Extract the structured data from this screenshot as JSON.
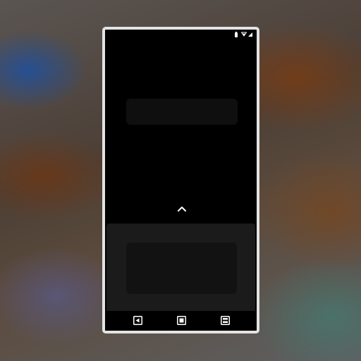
{
  "screen": {
    "status_bar": {
      "icons": [
        "battery-icon",
        "wifi-icon",
        "cellular-signal-icon"
      ]
    },
    "handle_icon": "chevron-up-icon",
    "nav_bar": {
      "buttons": [
        "back-icon",
        "home-icon",
        "recents-icon"
      ]
    }
  },
  "colors": {
    "screen_background": "#000000",
    "sheet_background": "#1b1b1b",
    "card_background": "#121212",
    "frame": "#e3e3e3",
    "icon": "#ffffff"
  }
}
